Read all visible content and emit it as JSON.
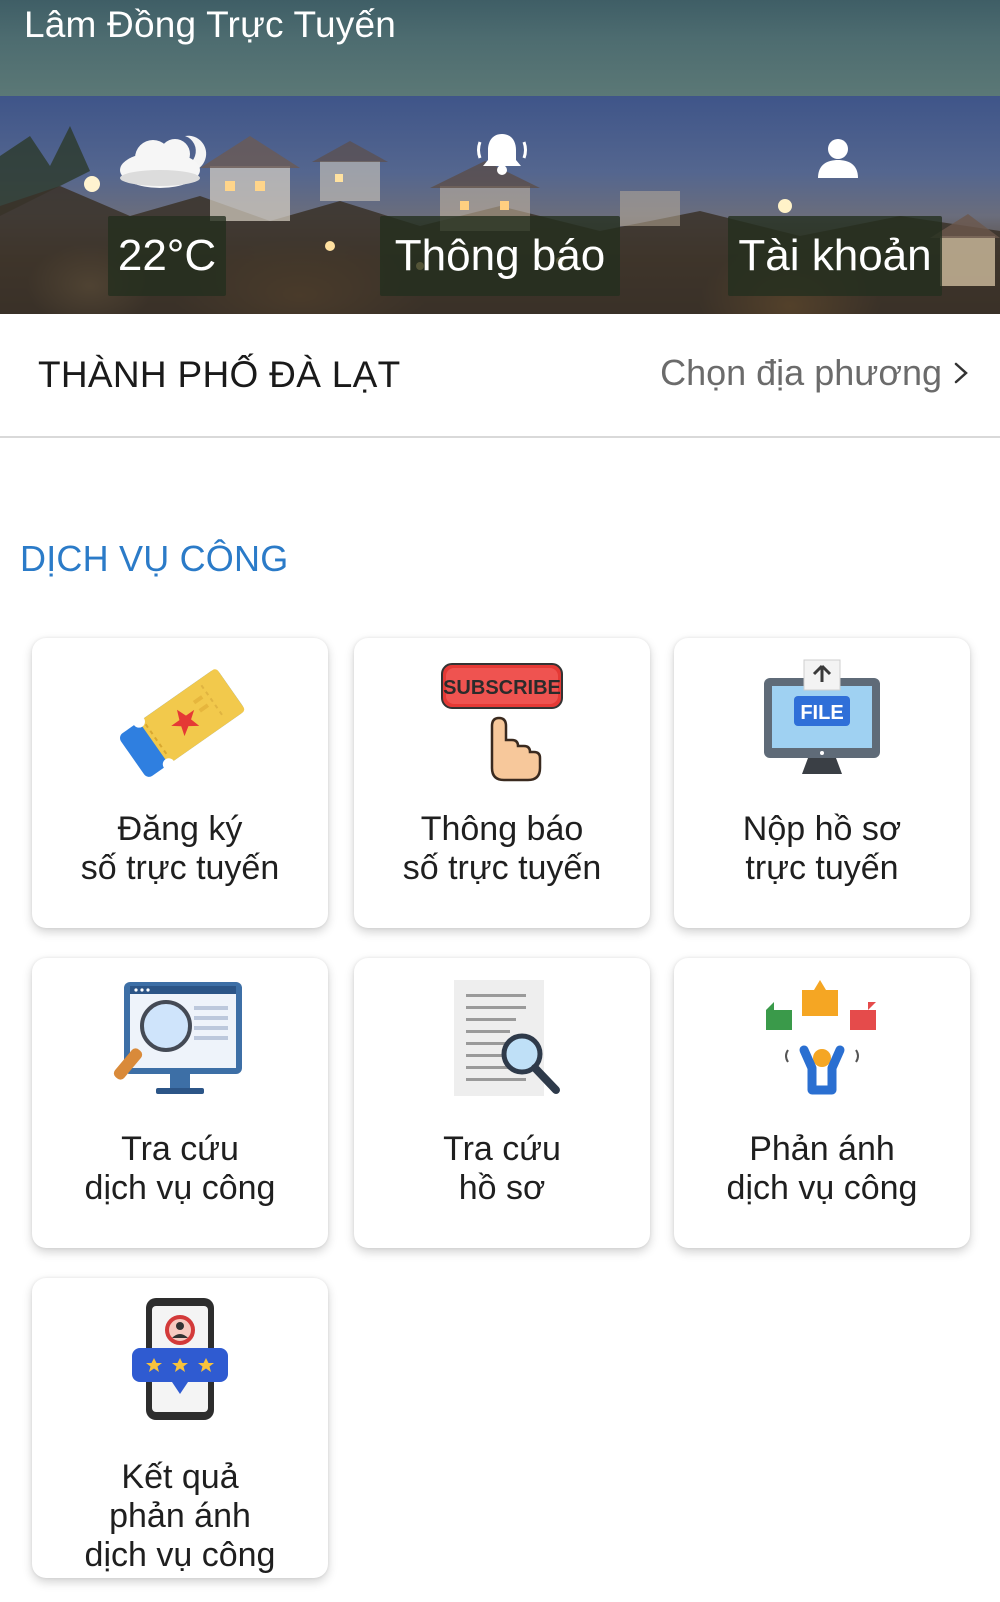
{
  "app": {
    "title": "Lâm Đồng Trực Tuyến"
  },
  "banner": {
    "temperature": "22°C",
    "notifications_label": "Thông báo",
    "account_label": "Tài khoản",
    "icons": [
      "weather-cloud-moon-icon",
      "bell-icon",
      "user-icon"
    ]
  },
  "location": {
    "current": "THÀNH PHỐ ĐÀ LẠT",
    "select_label": "Chọn địa phương"
  },
  "section": {
    "title": "DỊCH VỤ CÔNG"
  },
  "services": [
    {
      "label": "Đăng ký\nsố trực tuyến",
      "icon": "ticket-icon"
    },
    {
      "label": "Thông báo\nsố trực tuyến",
      "icon": "subscribe-click-icon",
      "icon_text": "SUBSCRIBE"
    },
    {
      "label": "Nộp hồ sơ\ntrực tuyến",
      "icon": "file-upload-monitor-icon",
      "icon_text": "FILE"
    },
    {
      "label": "Tra cứu\ndịch vụ công",
      "icon": "monitor-search-icon"
    },
    {
      "label": "Tra cứu\nhồ sơ",
      "icon": "document-search-icon"
    },
    {
      "label": "Phản ánh\ndịch vụ công",
      "icon": "feedback-person-icon"
    },
    {
      "label": "Kết quả\nphản ánh\ndịch vụ công",
      "icon": "phone-rating-icon"
    }
  ],
  "colors": {
    "accent": "#2b7bc8",
    "titlebar": "#4d6c70",
    "pill_bg": "#222e1e"
  }
}
